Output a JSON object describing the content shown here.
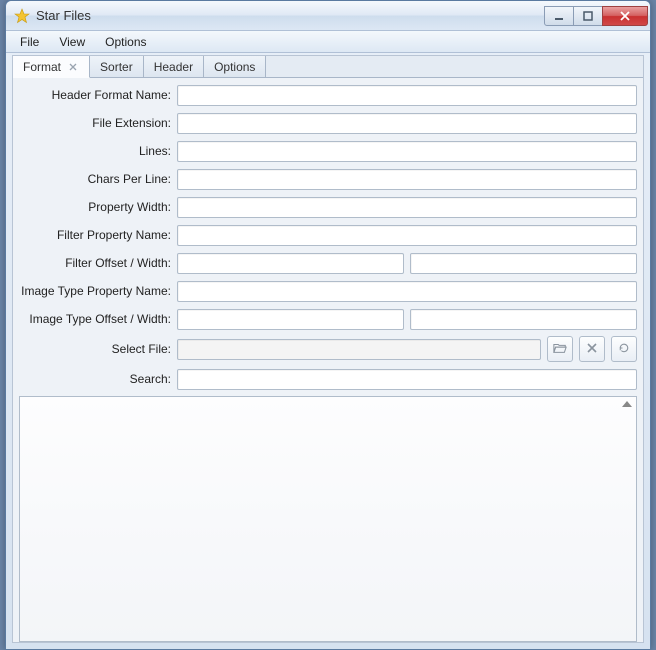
{
  "window": {
    "title": "Star Files"
  },
  "menubar": {
    "items": [
      "File",
      "View",
      "Options"
    ]
  },
  "tabs": [
    {
      "label": "Format",
      "active": true,
      "closable": true
    },
    {
      "label": "Sorter",
      "active": false,
      "closable": false
    },
    {
      "label": "Header",
      "active": false,
      "closable": false
    },
    {
      "label": "Options",
      "active": false,
      "closable": false
    }
  ],
  "form": {
    "header_format_name": {
      "label": "Header Format Name:",
      "value": ""
    },
    "file_extension": {
      "label": "File Extension:",
      "value": ""
    },
    "lines": {
      "label": "Lines:",
      "value": ""
    },
    "chars_per_line": {
      "label": "Chars Per Line:",
      "value": ""
    },
    "property_width": {
      "label": "Property Width:",
      "value": ""
    },
    "filter_property_name": {
      "label": "Filter Property Name:",
      "value": ""
    },
    "filter_offset_width": {
      "label": "Filter Offset / Width:",
      "offset": "",
      "width": ""
    },
    "image_type_property_name": {
      "label": "Image Type Property Name:",
      "value": ""
    },
    "image_type_offset_width": {
      "label": "Image Type Offset / Width:",
      "offset": "",
      "width": ""
    },
    "select_file": {
      "label": "Select File:",
      "value": ""
    },
    "search": {
      "label": "Search:",
      "value": ""
    }
  },
  "icons": {
    "open": "folder-open-icon",
    "clear": "close-icon",
    "refresh": "refresh-icon"
  }
}
